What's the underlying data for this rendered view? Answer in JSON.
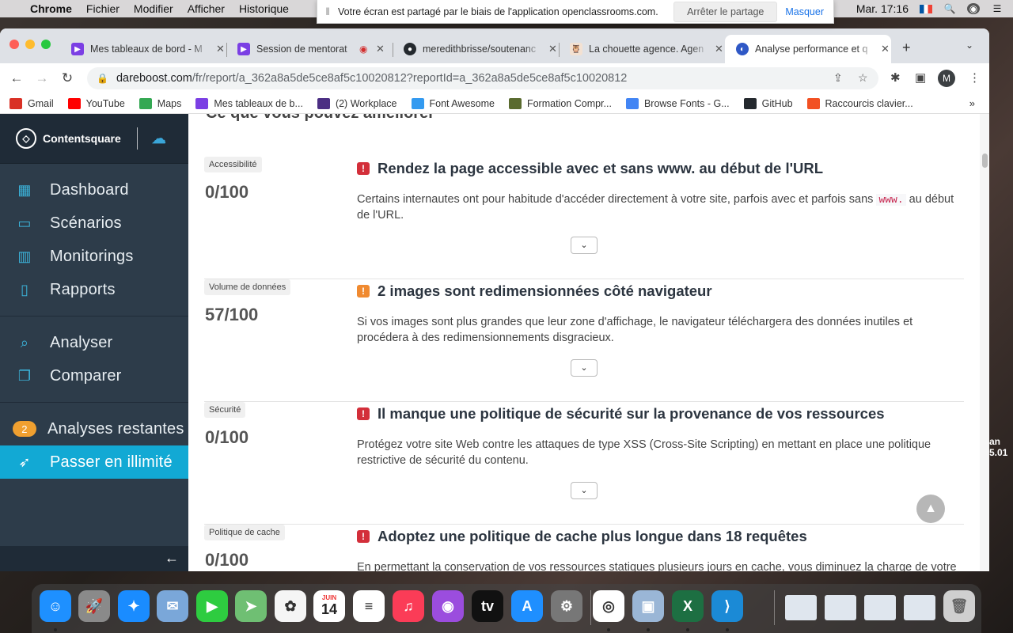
{
  "menubar": {
    "app": "Chrome",
    "items": [
      "Fichier",
      "Modifier",
      "Afficher",
      "Historique"
    ],
    "clock": "Mar. 17:16"
  },
  "share_bar": {
    "message": "Votre écran est partagé par le biais de l'application openclassrooms.com.",
    "stop_label": "Arrêter le partage",
    "hide_label": "Masquer"
  },
  "tabs": [
    {
      "title": "Mes tableaux de bord - M",
      "color": "#7b3fe4",
      "active": false
    },
    {
      "title": "Session de mentorat",
      "color": "#7b3fe4",
      "active": false
    },
    {
      "title": "meredithbrisse/soutenanc",
      "color": "#24292e",
      "active": false
    },
    {
      "title": "La chouette agence. Agen",
      "color": "#e9d3c0",
      "active": false
    },
    {
      "title": "Analyse performance et q",
      "color": "#2f58c6",
      "active": true
    }
  ],
  "address": {
    "domain": "dareboost.com",
    "path": "/fr/report/a_362a8a5de5ce8af5c10020812?reportId=a_362a8a5de5ce8af5c10020812"
  },
  "profile_initial": "M",
  "bookmarks": [
    {
      "label": "Gmail",
      "icon": "gmail-icon",
      "color": "#d93025"
    },
    {
      "label": "YouTube",
      "icon": "youtube-icon",
      "color": "#ff0000"
    },
    {
      "label": "Maps",
      "icon": "maps-icon",
      "color": "#34a853"
    },
    {
      "label": "Mes tableaux de b...",
      "icon": "openclassrooms-icon",
      "color": "#7b3fe4"
    },
    {
      "label": "(2) Workplace",
      "icon": "workplace-icon",
      "color": "#4b2e83"
    },
    {
      "label": "Font Awesome",
      "icon": "font-awesome-icon",
      "color": "#339af0"
    },
    {
      "label": "Formation Compr...",
      "icon": "formation-icon",
      "color": "#5a6b2f"
    },
    {
      "label": "Browse Fonts - G...",
      "icon": "google-fonts-icon",
      "color": "#4285f4"
    },
    {
      "label": "GitHub",
      "icon": "github-icon",
      "color": "#24292e"
    },
    {
      "label": "Raccourcis clavier...",
      "icon": "microsoft-icon",
      "color": "#f25022"
    }
  ],
  "sidebar": {
    "brand": "Contentsquare",
    "nav": [
      {
        "label": "Dashboard",
        "icon": "dashboard-icon"
      },
      {
        "label": "Scénarios",
        "icon": "scenarios-icon"
      },
      {
        "label": "Monitorings",
        "icon": "monitorings-icon"
      },
      {
        "label": "Rapports",
        "icon": "rapports-icon"
      }
    ],
    "tools": [
      {
        "label": "Analyser",
        "icon": "search-icon"
      },
      {
        "label": "Comparer",
        "icon": "compare-icon"
      }
    ],
    "remaining_count": "2",
    "remaining_label": "Analyses restantes",
    "upgrade_label": "Passer en illimité"
  },
  "report": {
    "section_title": "Ce que vous pouvez améliorer",
    "items": [
      {
        "category": "Accessibilité",
        "score": "0/100",
        "severity": "red",
        "title": "Rendez la page accessible avec et sans www. au début de l'URL",
        "desc_before": "Certains internautes ont pour habitude d'accéder directement à votre site, parfois avec et parfois sans ",
        "desc_code": "www.",
        "desc_after": " au début de l'URL."
      },
      {
        "category": "Volume de données",
        "score": "57/100",
        "severity": "orange",
        "title": "2 images sont redimensionnées côté navigateur",
        "desc_before": "Si vos images sont plus grandes que leur zone d'affichage, le navigateur téléchargera des données inutiles et procédera à des redimensionnements disgracieux.",
        "desc_code": "",
        "desc_after": ""
      },
      {
        "category": "Sécurité",
        "score": "0/100",
        "severity": "red",
        "title": "Il manque une politique de sécurité sur la provenance de vos ressources",
        "desc_before": "Protégez votre site Web contre les attaques de type XSS (Cross-Site Scripting) en mettant en place une politique restrictive de sécurité du contenu.",
        "desc_code": "",
        "desc_after": ""
      },
      {
        "category": "Politique de cache",
        "score": "0/100",
        "severity": "red",
        "title": "Adoptez une politique de cache plus longue dans 18 requêtes",
        "desc_before": "En permettant la conservation de vos ressources statiques plusieurs jours en cache, vous diminuez la charge de votre",
        "desc_code": "",
        "desc_after": ""
      }
    ]
  },
  "dock": {
    "calendar_month": "JUIN",
    "calendar_day": "14",
    "apps": [
      "finder",
      "launchpad",
      "safari",
      "mail",
      "facetime",
      "maps",
      "photos",
      "calendar",
      "reminders",
      "music",
      "podcasts",
      "tv",
      "app-store",
      "system-preferences",
      "chrome",
      "preview",
      "excel",
      "vscode"
    ]
  }
}
